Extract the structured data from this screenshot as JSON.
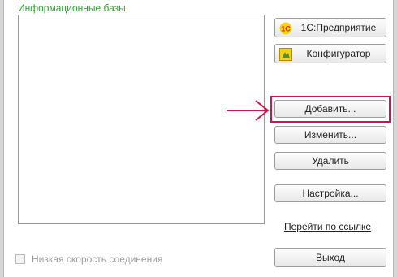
{
  "infobases": {
    "label": "Информационные базы",
    "items": []
  },
  "buttons": {
    "enterprise": "1С:Предприятие",
    "configurator": "Конфигуратор",
    "add": "Добавить...",
    "edit": "Изменить...",
    "delete": "Удалить",
    "settings": "Настройка...",
    "exit": "Выход"
  },
  "link": {
    "follow": "Перейти по ссылке"
  },
  "options": {
    "low_speed_label": "Низкая скорость соединения",
    "low_speed_checked": false
  },
  "icons": {
    "enterprise": "1c-logo-icon",
    "configurator": "configurator-icon",
    "pointer": "arrow-right-icon"
  },
  "colors": {
    "group_label": "#3a9a3a",
    "highlight": "#c8174b",
    "logo_red": "#d8252a",
    "logo_yellow": "#f5d21a"
  }
}
